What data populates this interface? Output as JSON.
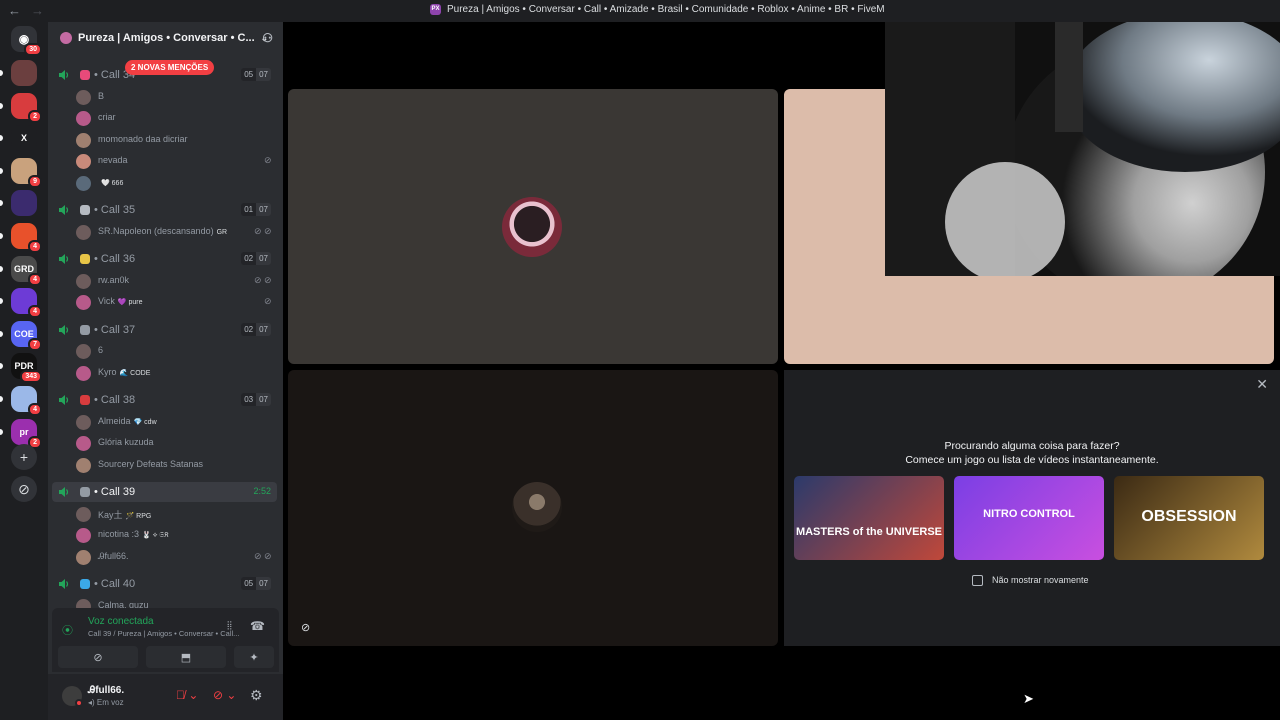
{
  "titlebar": {
    "back": "←",
    "forward": "→",
    "icon_text": "PX",
    "title": "Pureza | Amigos • Conversar • Call • Amizade • Brasil • Comunidade • Roblox • Anime • BR • FiveM"
  },
  "rail": {
    "home_badge": "30",
    "servers": [
      {
        "label": "",
        "badge": "",
        "color": "#6b3f3f"
      },
      {
        "label": "",
        "badge": "2",
        "color": "#d83c3e"
      },
      {
        "label": "X",
        "badge": "",
        "color": "#1e1f22"
      },
      {
        "label": "",
        "badge": "9",
        "color": "#c9a27d"
      },
      {
        "label": "",
        "badge": "",
        "color": "#3b2b6e"
      },
      {
        "label": "",
        "badge": "4",
        "color": "#e8512b"
      },
      {
        "label": "GRD",
        "badge": "4",
        "color": "#4a4a4a"
      },
      {
        "label": "",
        "badge": "4",
        "color": "#6d3bd6"
      },
      {
        "label": "COE",
        "badge": "7",
        "color": "#5865f2"
      },
      {
        "label": "PDR",
        "badge": "343",
        "color": "#111111"
      },
      {
        "label": "",
        "badge": "4",
        "color": "#9bb8e8"
      },
      {
        "label": "pr",
        "badge": "2",
        "color": "#9b2fae"
      }
    ],
    "add_icon": "+",
    "discover_icon": "⊘"
  },
  "guild": {
    "name": "Pureza | Amigos • Conversar • C...",
    "new_mentions": "2 NOVAS MENÇÕES"
  },
  "channels": [
    {
      "name": "Call 34",
      "counts": [
        "05",
        "07"
      ],
      "emoji_color": "#e84a7a",
      "users": [
        {
          "name": "B",
          "tag": ""
        },
        {
          "name": "criar",
          "tag": ""
        },
        {
          "name": "momonado daa dicriar",
          "tag": ""
        },
        {
          "name": "nevada",
          "tag": "",
          "icon": "⊘"
        },
        {
          "name": "",
          "tag": "🤍 666"
        }
      ]
    },
    {
      "name": "Call 35",
      "counts": [
        "01",
        "07"
      ],
      "emoji_color": "#b5bac1",
      "users": [
        {
          "name": "SR.Napoleon (descansando)",
          "tag": "GR",
          "icon": "⊘ ⊘"
        }
      ]
    },
    {
      "name": "Call 36",
      "counts": [
        "02",
        "07"
      ],
      "emoji_color": "#e8c547",
      "users": [
        {
          "name": "rw.an0k",
          "tag": "",
          "icon": "⊘ ⊘"
        },
        {
          "name": "Vick",
          "tag": "💜 pure",
          "icon": "⊘"
        }
      ]
    },
    {
      "name": "Call 37",
      "counts": [
        "02",
        "07"
      ],
      "emoji_color": "#949ba4",
      "users": [
        {
          "name": "6",
          "tag": ""
        },
        {
          "name": "Kyro",
          "tag": "🌊 CODE"
        }
      ]
    },
    {
      "name": "Call 38",
      "counts": [
        "03",
        "07"
      ],
      "emoji_color": "#d83c3e",
      "users": [
        {
          "name": "Almeida",
          "tag": "💎 cdw"
        },
        {
          "name": "Glória kuzuda",
          "tag": ""
        },
        {
          "name": "Sourcery Defeats Satanas",
          "tag": ""
        }
      ]
    },
    {
      "name": "Call 39",
      "timer": "2:52",
      "emoji_color": "#949ba4",
      "users": [
        {
          "name": "Kay土",
          "tag": "🪄 RPG"
        },
        {
          "name": "nicotina :3",
          "tag": "🐰 ⟡ 𝔖𝔎"
        },
        {
          "name": "Ꭿfull66.",
          "tag": "",
          "icon": "⊘ ⊘"
        }
      ]
    },
    {
      "name": "Call 40",
      "counts": [
        "05",
        "07"
      ],
      "emoji_color": "#3ba9e8",
      "users": [
        {
          "name": "Calma, quzu",
          "tag": ""
        }
      ]
    }
  ],
  "voice": {
    "status": "Voz conectada",
    "location": "Call 39 / Pureza | Amigos • Conversar • Call...",
    "actions": [
      "⊘",
      "⬒",
      "✦"
    ]
  },
  "user": {
    "name": "Ꭿfull66.",
    "status": "Em voz",
    "gear": "⚙"
  },
  "activity": {
    "close": "✕",
    "line1": "Procurando alguma coisa para fazer?",
    "line2": "Comece um jogo ou lista de vídeos instantaneamente.",
    "cards": [
      {
        "label": "MASTERS of the UNIVERSE",
        "color1": "#2b3a6b",
        "color2": "#c0483a"
      },
      {
        "label": "NITRO CONTROL",
        "color1": "#7b3fe4",
        "color2": "#c94fe0"
      },
      {
        "label": "OBSESSION",
        "color1": "#3b2a14",
        "color2": "#b08a3e"
      }
    ],
    "checkbox_label": "Não mostrar novamente"
  }
}
